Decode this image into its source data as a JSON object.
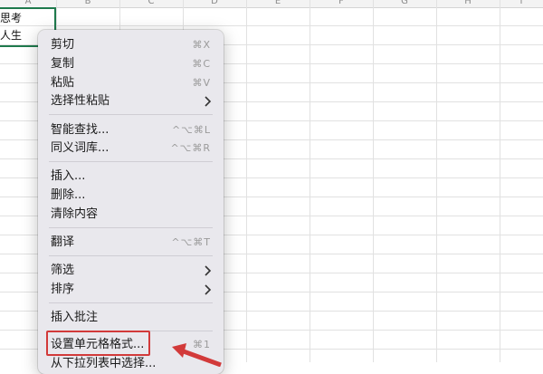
{
  "sheet": {
    "columns": [
      "A",
      "B",
      "C",
      "D",
      "E",
      "F",
      "G",
      "H",
      "I"
    ],
    "cells": {
      "a1_line1": "思考",
      "a1_line2": "人生"
    }
  },
  "context_menu": {
    "items": [
      {
        "label": "剪切",
        "shortcut": "⌘X"
      },
      {
        "label": "复制",
        "shortcut": "⌘C"
      },
      {
        "label": "粘贴",
        "shortcut": "⌘V"
      },
      {
        "label": "选择性粘贴",
        "submenu": true
      },
      {
        "label": "智能查找...",
        "shortcut": "^⌥⌘L"
      },
      {
        "label": "同义词库...",
        "shortcut": "^⌥⌘R"
      },
      {
        "label": "插入..."
      },
      {
        "label": "删除..."
      },
      {
        "label": "清除内容"
      },
      {
        "label": "翻译",
        "shortcut": "^⌥⌘T"
      },
      {
        "label": "筛选",
        "submenu": true
      },
      {
        "label": "排序",
        "submenu": true
      },
      {
        "label": "插入批注"
      },
      {
        "label": "设置单元格格式...",
        "shortcut": "⌘1"
      },
      {
        "label": "从下拉列表中选择..."
      }
    ]
  },
  "colors": {
    "highlight": "#d23a3a",
    "selection": "#1f7a4d"
  }
}
